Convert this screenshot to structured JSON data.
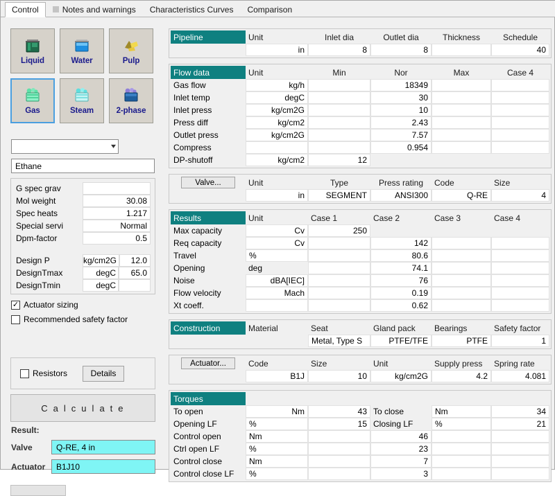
{
  "tabs": [
    {
      "label": "Control",
      "active": true,
      "has_mark": false
    },
    {
      "label": "Notes and warnings",
      "active": false,
      "has_mark": true
    },
    {
      "label": "Characteristics Curves",
      "active": false,
      "has_mark": false
    },
    {
      "label": "Comparison",
      "active": false,
      "has_mark": false
    }
  ],
  "colors": {
    "section_header_teal": "#0f8080",
    "result_field_cyan": "#7ff5f5",
    "button_face": "#d6d2ca",
    "selection_blue": "#4a9fe0",
    "button_label_blue": "#1a1a8c"
  },
  "sidebar": {
    "fluid_buttons": [
      {
        "label": "Liquid",
        "icon": "liquid-beaker-icon",
        "selected": false
      },
      {
        "label": "Water",
        "icon": "water-beaker-icon",
        "selected": false
      },
      {
        "label": "Pulp",
        "icon": "pulp-icon",
        "selected": false
      },
      {
        "label": "Gas",
        "icon": "gas-beaker-icon",
        "selected": true
      },
      {
        "label": "Steam",
        "icon": "steam-beaker-icon",
        "selected": false
      },
      {
        "label": "2-phase",
        "icon": "two-phase-icon",
        "selected": false
      }
    ],
    "fluid_combo": {
      "value": "",
      "icon": "chevron-down-icon"
    },
    "fluid_name": "Ethane",
    "properties": [
      {
        "label": "G spec grav",
        "unit": "",
        "value": ""
      },
      {
        "label": "Mol weight",
        "unit": "",
        "value": "30.08"
      },
      {
        "label": "Spec heats",
        "unit": "",
        "value": "1.217"
      },
      {
        "label": "Special servi",
        "unit": "",
        "value": "Normal"
      },
      {
        "label": "Dpm-factor",
        "unit": "",
        "value": "0.5"
      }
    ],
    "design": [
      {
        "label": "Design P",
        "unit": "kg/cm2G",
        "value": "12.0"
      },
      {
        "label": "DesignTmax",
        "unit": "degC",
        "value": "65.0"
      },
      {
        "label": "DesignTmin",
        "unit": "degC",
        "value": ""
      }
    ],
    "checkboxes": [
      {
        "label": "Actuator sizing",
        "checked": true
      },
      {
        "label": "Recommended safety factor",
        "checked": false
      }
    ],
    "resistors": {
      "label": "Resistors",
      "checked": false,
      "details_button": "Details"
    },
    "calculate_button": "C a l c u l a t e",
    "result_heading": "Result:",
    "results": [
      {
        "label": "Valve",
        "value": "Q-RE, 4 in"
      },
      {
        "label": "Actuator",
        "value": "B1J10"
      }
    ]
  },
  "pipeline": {
    "title": "Pipeline",
    "headers": [
      "Unit",
      "Inlet dia",
      "Outlet dia",
      "Thickness",
      "Schedule"
    ],
    "row": [
      "in",
      "8",
      "8",
      "",
      "40"
    ]
  },
  "flow_data": {
    "title": "Flow data",
    "headers": [
      "Unit",
      "Min",
      "Nor",
      "Max",
      "Case 4"
    ],
    "rows": [
      {
        "label": "Gas flow",
        "unit": "kg/h",
        "min": "",
        "nor": "18349",
        "max": "",
        "case4": ""
      },
      {
        "label": "Inlet temp",
        "unit": "degC",
        "min": "",
        "nor": "30",
        "max": "",
        "case4": ""
      },
      {
        "label": "Inlet press",
        "unit": "kg/cm2G",
        "min": "",
        "nor": "10",
        "max": "",
        "case4": ""
      },
      {
        "label": "Press diff",
        "unit": "kg/cm2",
        "min": "",
        "nor": "2.43",
        "max": "",
        "case4": ""
      },
      {
        "label": "Outlet press",
        "unit": "kg/cm2G",
        "min": "",
        "nor": "7.57",
        "max": "",
        "case4": ""
      },
      {
        "label": "Compress",
        "unit": "",
        "min": "",
        "nor": "0.954",
        "max": "",
        "case4": ""
      },
      {
        "label": "DP-shutoff",
        "unit": "kg/cm2",
        "min": "12",
        "nor": "",
        "max": "",
        "case4": ""
      }
    ]
  },
  "valve": {
    "button": "Valve...",
    "headers": [
      "Unit",
      "Type",
      "Press rating",
      "Code",
      "Size"
    ],
    "row": [
      "in",
      "SEGMENT",
      "ANSI300",
      "Q-RE",
      "4"
    ]
  },
  "results_table": {
    "title": "Results",
    "headers": [
      "Unit",
      "Case 1",
      "Case 2",
      "Case 3",
      "Case 4"
    ],
    "rows": [
      {
        "label": "Max capacity",
        "unit": "Cv",
        "case1": "250",
        "case2": "",
        "case3": "",
        "case4": ""
      },
      {
        "label": "Req capacity",
        "unit": "Cv",
        "case1": "",
        "case2": "142",
        "case3": "",
        "case4": ""
      },
      {
        "label": "Travel",
        "unit": "%",
        "case1": "",
        "case2": "80.6",
        "case3": "",
        "case4": ""
      },
      {
        "label": "Opening",
        "unit": "deg",
        "case1": "",
        "case2": "74.1",
        "case3": "",
        "case4": ""
      },
      {
        "label": "Noise",
        "unit": "dBA[IEC]",
        "case1": "",
        "case2": "76",
        "case3": "",
        "case4": ""
      },
      {
        "label": "Flow velocity",
        "unit": "Mach",
        "case1": "",
        "case2": "0.19",
        "case3": "",
        "case4": ""
      },
      {
        "label": "Xt coeff.",
        "unit": "",
        "case1": "",
        "case2": "0.62",
        "case3": "",
        "case4": ""
      }
    ]
  },
  "construction": {
    "title": "Construction",
    "headers": [
      "Material",
      "Seat",
      "Gland pack",
      "Bearings",
      "Safety factor"
    ],
    "row": [
      "",
      "Metal,  Type S ",
      "PTFE/TFE",
      "PTFE",
      "1"
    ]
  },
  "actuator": {
    "button": "Actuator...",
    "headers": [
      "Code",
      "Size",
      "Unit",
      "Supply press",
      "Spring rate"
    ],
    "row": [
      "B1J",
      "10",
      "kg/cm2G",
      "4.2",
      "4.081"
    ]
  },
  "torques": {
    "title": "Torques",
    "rows": [
      {
        "label": "To open",
        "unit": "Nm",
        "value": "43",
        "label2": "To close",
        "unit2": "Nm",
        "value2": "34"
      },
      {
        "label": "Opening LF",
        "unit": "%",
        "value": "15",
        "label2": "Closing LF",
        "unit2": "%",
        "value2": "21"
      },
      {
        "label": "Control open",
        "unit": "Nm",
        "value": "46",
        "label2": "",
        "unit2": "",
        "value2": ""
      },
      {
        "label": "Ctrl open LF",
        "unit": "%",
        "value": "23",
        "label2": "",
        "unit2": "",
        "value2": ""
      },
      {
        "label": "Control close",
        "unit": "Nm",
        "value": "7",
        "label2": "",
        "unit2": "",
        "value2": ""
      },
      {
        "label": "Control close LF",
        "unit": "%",
        "value": "3",
        "label2": "",
        "unit2": "",
        "value2": ""
      }
    ]
  }
}
